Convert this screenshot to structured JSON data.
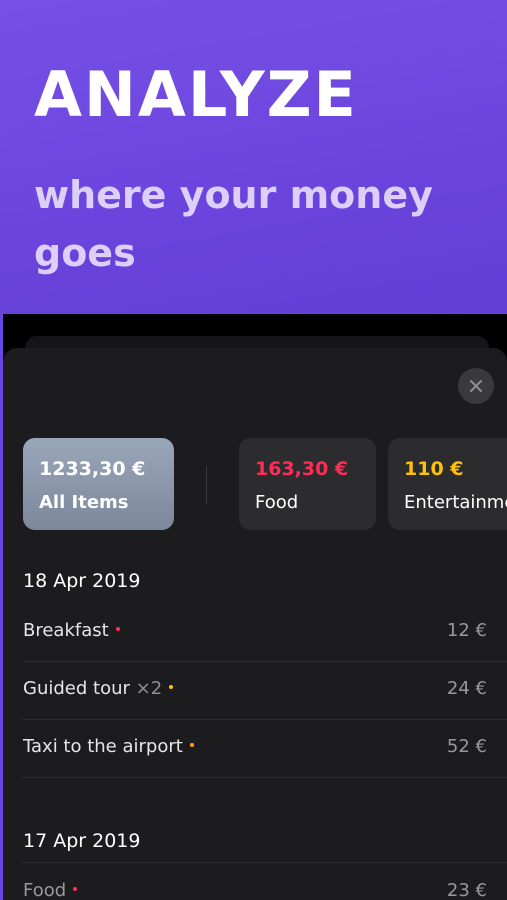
{
  "hero": {
    "title": "ANALYZE",
    "subtitle": "where your money goes"
  },
  "colors": {
    "accent_purple": "#6a45e0",
    "food_red": "#ff2d55",
    "entertainment_yellow": "#ffc107",
    "sheet_bg": "#1c1c1e"
  },
  "icons": {
    "close": "close-icon"
  },
  "summary": [
    {
      "amount": "1233,30 €",
      "label": "All Items",
      "amount_color": "#ffffff"
    },
    {
      "amount": "163,30 €",
      "label": "Food",
      "amount_color": "#ff2d55"
    },
    {
      "amount": "110 €",
      "label": "Entertainment",
      "amount_color": "#ffc107"
    }
  ],
  "groups": [
    {
      "date": "18 Apr 2019",
      "items": [
        {
          "name": "Breakfast",
          "qty": "",
          "amount": "12 €",
          "dot_color": "#ff2d55"
        },
        {
          "name": "Guided tour",
          "qty": "×2",
          "amount": "24 €",
          "dot_color": "#ffc107"
        },
        {
          "name": "Taxi to the airport",
          "qty": "",
          "amount": "52 €",
          "dot_color": "#ff9f0a"
        }
      ]
    },
    {
      "date": "17 Apr 2019",
      "items": [
        {
          "name": "Food",
          "qty": "",
          "amount": "23 €",
          "dot_color": "#ff2d55"
        }
      ]
    }
  ]
}
